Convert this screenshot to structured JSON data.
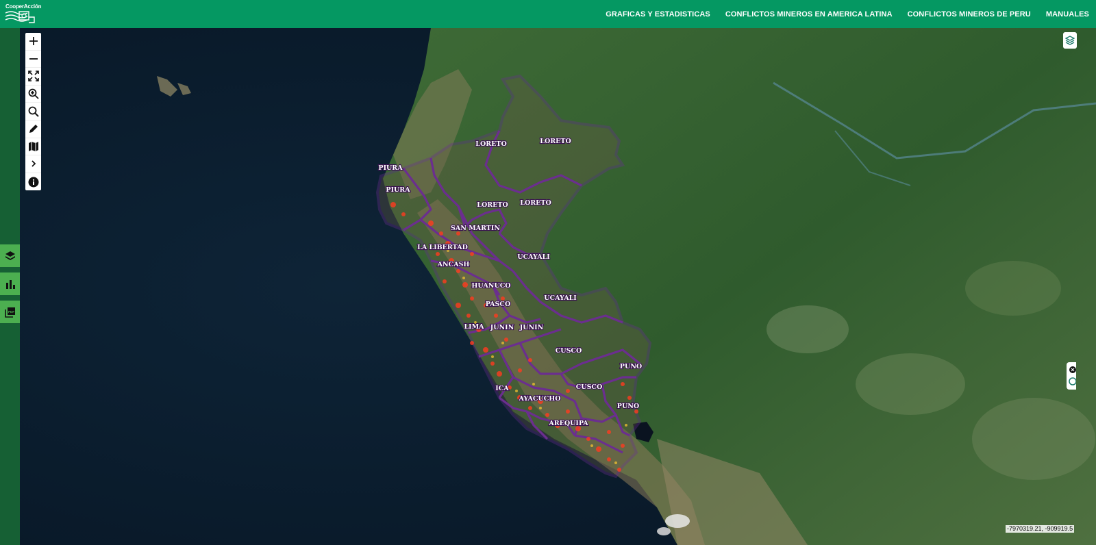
{
  "header": {
    "logo_text": "CooperAcción",
    "nav": [
      "GRAFICAS Y ESTADISTICAS",
      "CONFLICTOS MINEROS EN AMERICA LATINA",
      "CONFLICTOS MINEROS DE PERU",
      "MANUALES"
    ]
  },
  "toolbar": {
    "tools": [
      "zoom-in",
      "zoom-out",
      "full-extent",
      "zoom-box",
      "search",
      "draw",
      "basemap",
      "expand",
      "info"
    ]
  },
  "sidebar": {
    "buttons": [
      "layers",
      "charts",
      "pdf"
    ]
  },
  "map": {
    "region_labels": [
      "LORETO",
      "LORETO",
      "LORETO",
      "LORETO",
      "PIURA",
      "PIURA",
      "SAN MARTIN",
      "LA LIBERTAD",
      "ANCASH",
      "UCAYALI",
      "UCAYALI",
      "HUANUCO",
      "PASCO",
      "LIMA",
      "JUNIN",
      "JUNIN",
      "CUSCO",
      "CUSCO",
      "PUNO",
      "PUNO",
      "ICA",
      "AYACUCHO",
      "AREQUIPA"
    ],
    "boundary_color": "#6b2e8f",
    "concession_color": "#e8412a"
  },
  "status": {
    "coordinates": "-7970319.21, -909919.5"
  }
}
